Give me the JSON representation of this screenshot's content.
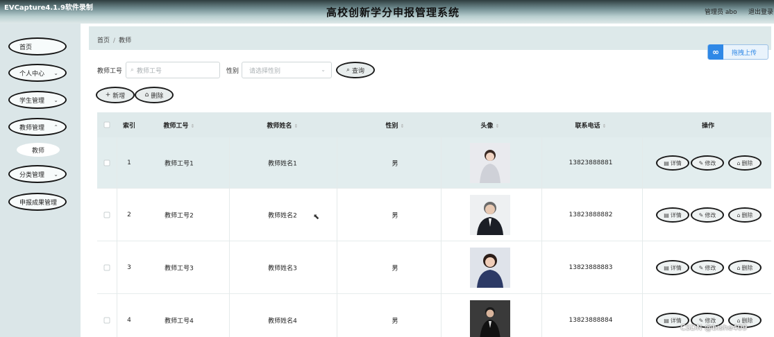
{
  "app": {
    "recorder_watermark": "EVCapture4.1.9软件录制",
    "title": "高校创新学分申报管理系统",
    "user": "管理员 abo",
    "logout": "退出登录"
  },
  "sidebar": {
    "items": [
      {
        "label": "首页",
        "has_chevron": false
      },
      {
        "label": "个人中心",
        "has_chevron": true
      },
      {
        "label": "学生管理",
        "has_chevron": true
      },
      {
        "label": "教师管理",
        "has_chevron": true
      },
      {
        "label": "分类管理",
        "has_chevron": true
      },
      {
        "label": "申报成果管理",
        "has_chevron": false
      }
    ],
    "sub_item": "教师"
  },
  "breadcrumb": {
    "home": "首页",
    "current": "教师"
  },
  "upload": {
    "label": "拖拽上传"
  },
  "filters": {
    "id_label": "教师工号",
    "id_placeholder": "教师工号",
    "gender_label": "性别",
    "gender_placeholder": "请选择性别",
    "search_btn": "查询"
  },
  "actions": {
    "add": "新增",
    "delete": "删除"
  },
  "table": {
    "headers": {
      "index": "索引",
      "teacher_id": "教师工号",
      "teacher_name": "教师姓名",
      "gender": "性别",
      "avatar": "头像",
      "phone": "联系电话",
      "ops": "操作"
    },
    "rows": [
      {
        "index": "1",
        "teacher_id": "教师工号1",
        "teacher_name": "教师姓名1",
        "gender": "男",
        "phone": "13823888881",
        "photo_style": "woman-light"
      },
      {
        "index": "2",
        "teacher_id": "教师工号2",
        "teacher_name": "教师姓名2",
        "gender": "男",
        "phone": "13823888882",
        "photo_style": "man-grey"
      },
      {
        "index": "3",
        "teacher_id": "教师工号3",
        "teacher_name": "教师姓名3",
        "gender": "男",
        "phone": "13823888883",
        "photo_style": "woman-dark"
      },
      {
        "index": "4",
        "teacher_id": "教师工号4",
        "teacher_name": "教师姓名4",
        "gender": "男",
        "phone": "13823888884",
        "photo_style": "man-dark"
      }
    ],
    "row_ops": {
      "detail": "详情",
      "edit": "修改",
      "delete": "删除"
    }
  },
  "footer_watermark": "CSDN @bishe409",
  "icons": {
    "search": "search-icon",
    "plus": "plus-icon",
    "trash": "trash-icon",
    "detail": "document-icon",
    "edit": "pencil-icon",
    "upload": "cloud-upload-icon",
    "chevron": "chevron-down-icon",
    "sort": "sort-icon"
  },
  "colors": {
    "sidebar_bg": "#dbe6e8",
    "header_bg": "#dfeaeb",
    "highlight_row": "#e2edee",
    "upload_blue": "#2f88e6"
  }
}
